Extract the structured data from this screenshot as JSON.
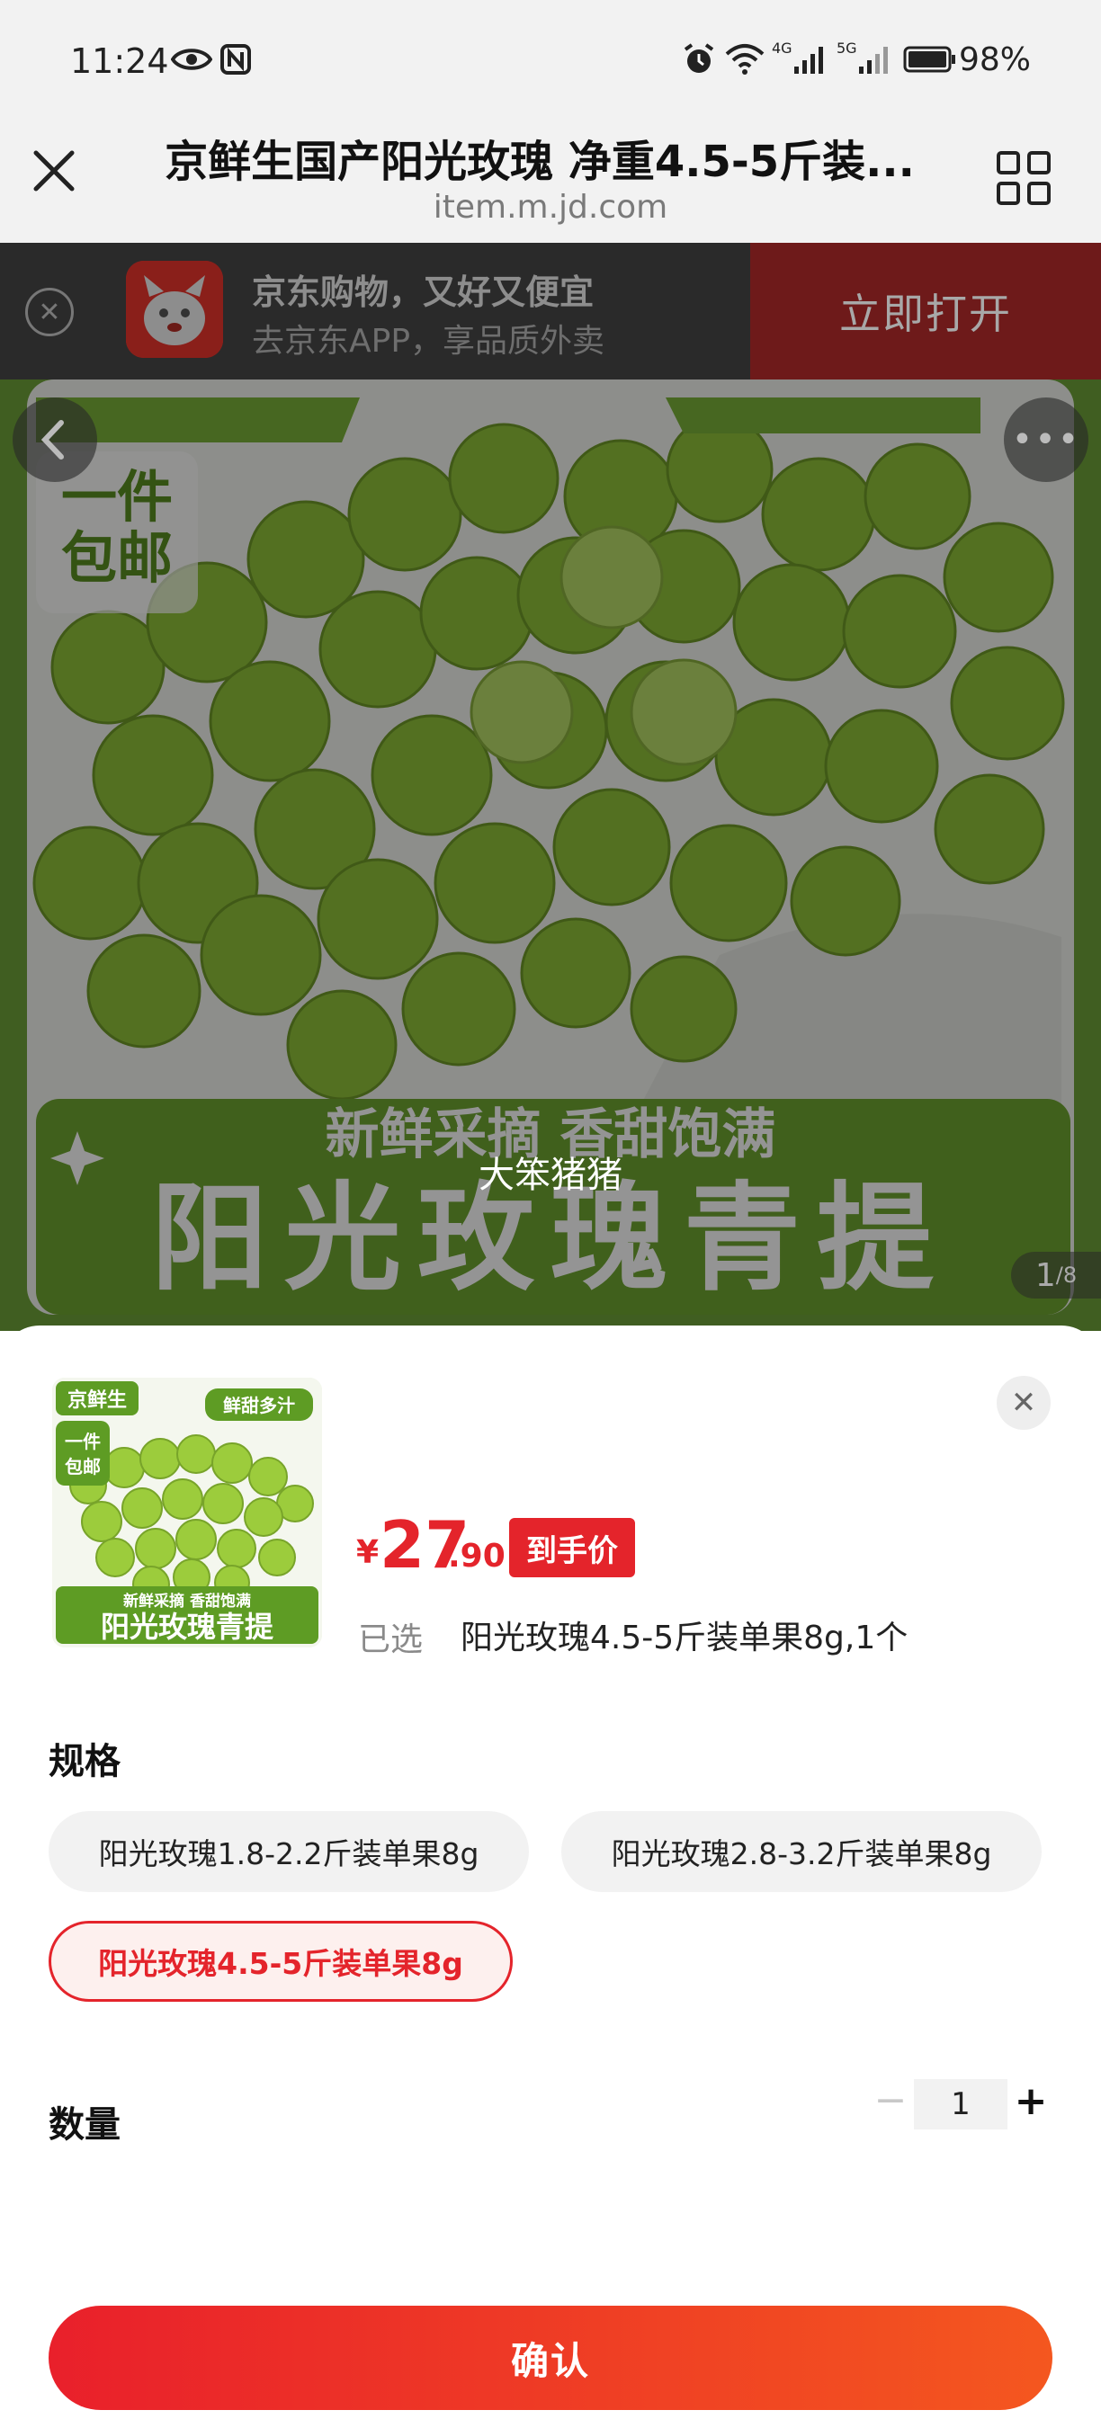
{
  "status_bar": {
    "time": "11:24",
    "signal_1": "4G",
    "signal_2": "5G",
    "battery": "98%"
  },
  "browser": {
    "title": "京鲜生国产阳光玫瑰 净重4.5-5斤装...",
    "url": "item.m.jd.com"
  },
  "app_banner": {
    "title": "京东购物，又好又便宜",
    "subtitle": "去京东APP，享品质外卖",
    "open_button": "立即打开"
  },
  "hero": {
    "image_text_top_left_1": "一件",
    "image_text_top_left_2": "包邮",
    "image_text_bottom_1": "新鲜采摘 香甜饱满",
    "image_text_bottom_2": "阳光玫瑰青提",
    "counter_current": "1",
    "counter_total": "/8",
    "watermark": "大笨猪猪"
  },
  "thumbnail": {
    "brand": "京鲜生",
    "badge": "鲜甜多汁",
    "line1": "一件",
    "line2": "包邮",
    "tagline": "新鲜采摘 香甜饱满",
    "name": "阳光玫瑰青提"
  },
  "price": {
    "symbol": "¥",
    "integer": "27",
    "decimal": ".90",
    "tag": "到手价"
  },
  "selected": {
    "label": "已选",
    "value": "阳光玫瑰4.5-5斤装单果8g,1个"
  },
  "spec": {
    "heading": "规格",
    "options": [
      {
        "label": "阳光玫瑰1.8-2.2斤装单果8g"
      },
      {
        "label": "阳光玫瑰2.8-3.2斤装单果8g"
      },
      {
        "label": "阳光玫瑰4.5-5斤装单果8g"
      }
    ]
  },
  "quantity": {
    "heading": "数量",
    "value": "1",
    "minus": "−",
    "plus": "+"
  },
  "confirm_label": "确认",
  "colors": {
    "accent": "#e4242b",
    "button_gradient_end": "#f4571f"
  }
}
